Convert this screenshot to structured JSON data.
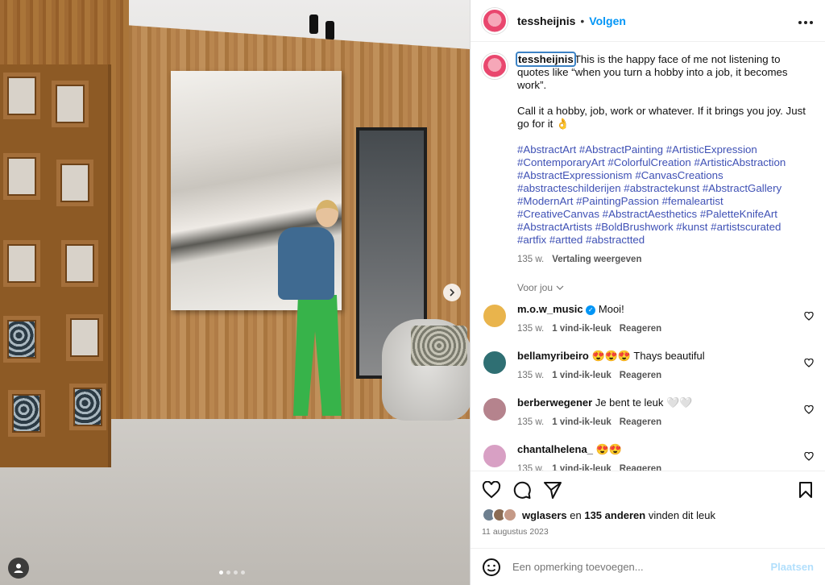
{
  "post": {
    "username": "tessheijnis",
    "separator": "•",
    "follow_label": "Volgen",
    "more_label": "•••"
  },
  "caption": {
    "username": "tessheijnis",
    "line1": "This is the happy face of me not listening to quotes like “when you turn a hobby into a job, it becomes work”.",
    "line2": "Call it a hobby, job, work or whatever. If it brings you joy. Just go for it 👌",
    "hashtags": "#AbstractArt #AbstractPainting #ArtisticExpression #ContemporaryArt #ColorfulCreation #ArtisticAbstraction #AbstractExpressionism #CanvasCreations #abstracteschilderijen #abstractekunst #AbstractGallery #ModernArt #PaintingPassion #femaleartist #CreativeCanvas #AbstractAesthetics #PaletteKnifeArt #AbstractArtists #BoldBrushwork #kunst #artistscurated #artfix #artted #abstractted",
    "time": "135 w.",
    "translate_label": "Vertaling weergeven"
  },
  "for_you_label": "Voor jou",
  "comments": [
    {
      "user": "m.o.w_music",
      "text": "Mooi!",
      "time": "135 w.",
      "likes": "1 vind-ik-leuk",
      "reply": "Reageren",
      "color": "#e9b44c"
    },
    {
      "user": "bellamyribeiro",
      "text": "😍😍😍 Thays beautiful",
      "time": "135 w.",
      "likes": "1 vind-ik-leuk",
      "reply": "Reageren",
      "color": "#2f6f73"
    },
    {
      "user": "berberwegener",
      "text": "Je bent te leuk 🤍🤍",
      "time": "135 w.",
      "likes": "1 vind-ik-leuk",
      "reply": "Reageren",
      "color": "#b5838d"
    },
    {
      "user": "chantalhelena_",
      "text": "😍😍",
      "time": "135 w.",
      "likes": "1 vind-ik-leuk",
      "reply": "Reageren",
      "color": "#d8a0c4"
    }
  ],
  "likes_line": {
    "user": "wglasers",
    "middle": " en ",
    "count": "135 anderen",
    "tail": " vinden dit leuk"
  },
  "date": "11 augustus 2023",
  "add_comment": {
    "placeholder": "Een opmerking toevoegen...",
    "post_label": "Plaatsen"
  },
  "colors": {
    "link_blue": "#0095f6",
    "hashtag": "#3f51b5",
    "muted": "#737373"
  },
  "carousel": {
    "current": 1,
    "total": 4
  }
}
